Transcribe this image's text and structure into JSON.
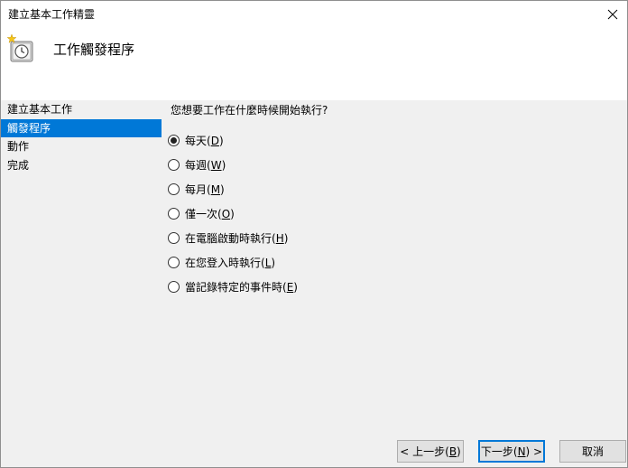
{
  "window": {
    "title": "建立基本工作精靈",
    "close_glyph": "✕"
  },
  "header": {
    "title": "工作觸發程序",
    "icon": "clock-wizard-icon"
  },
  "sidebar": {
    "items": [
      {
        "label": "建立基本工作",
        "active": false
      },
      {
        "label": "觸發程序",
        "active": true
      },
      {
        "label": "動作",
        "active": false
      },
      {
        "label": "完成",
        "active": false
      }
    ]
  },
  "main": {
    "question": "您想要工作在什麼時候開始執行?",
    "options": [
      {
        "prefix": "每天(",
        "key": "D",
        "suffix": ")",
        "checked": true
      },
      {
        "prefix": "每週(",
        "key": "W",
        "suffix": ")",
        "checked": false
      },
      {
        "prefix": "每月(",
        "key": "M",
        "suffix": ")",
        "checked": false
      },
      {
        "prefix": "僅一次(",
        "key": "O",
        "suffix": ")",
        "checked": false
      },
      {
        "prefix": "在電腦啟動時執行(",
        "key": "H",
        "suffix": ")",
        "checked": false
      },
      {
        "prefix": "在您登入時執行(",
        "key": "L",
        "suffix": ")",
        "checked": false
      },
      {
        "prefix": "當記錄特定的事件時(",
        "key": "E",
        "suffix": ")",
        "checked": false
      }
    ]
  },
  "footer": {
    "back": {
      "prefix": "< 上一步(",
      "key": "B",
      "suffix": ")"
    },
    "next": {
      "prefix": "下一步(",
      "key": "N",
      "suffix": ") >"
    },
    "cancel": "取消"
  },
  "colors": {
    "selection": "#0078d7",
    "background": "#f0f0f0"
  }
}
